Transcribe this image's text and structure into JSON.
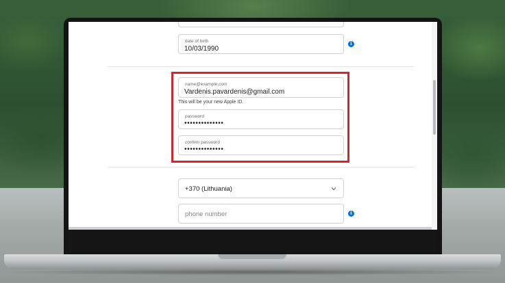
{
  "form": {
    "dob": {
      "label": "date of birth",
      "value": "10/03/1990"
    },
    "email": {
      "label": "name@example.com",
      "value": "Vardenis.pavardenis@gmail.com"
    },
    "email_helper": "This will be your new Apple ID.",
    "password": {
      "label": "password",
      "value": "••••••••••••••"
    },
    "confirm_password": {
      "label": "confirm password",
      "value": "••••••••••••••"
    },
    "country_code": {
      "value": "+370 (Lithuania)"
    },
    "phone": {
      "placeholder": "phone number"
    },
    "info_glyph": "i"
  },
  "colors": {
    "accent": "#0071e3",
    "highlight": "#d0262c",
    "field_border": "#d2d2d7"
  },
  "icons": [
    "info-icon",
    "chevron-down-icon"
  ]
}
